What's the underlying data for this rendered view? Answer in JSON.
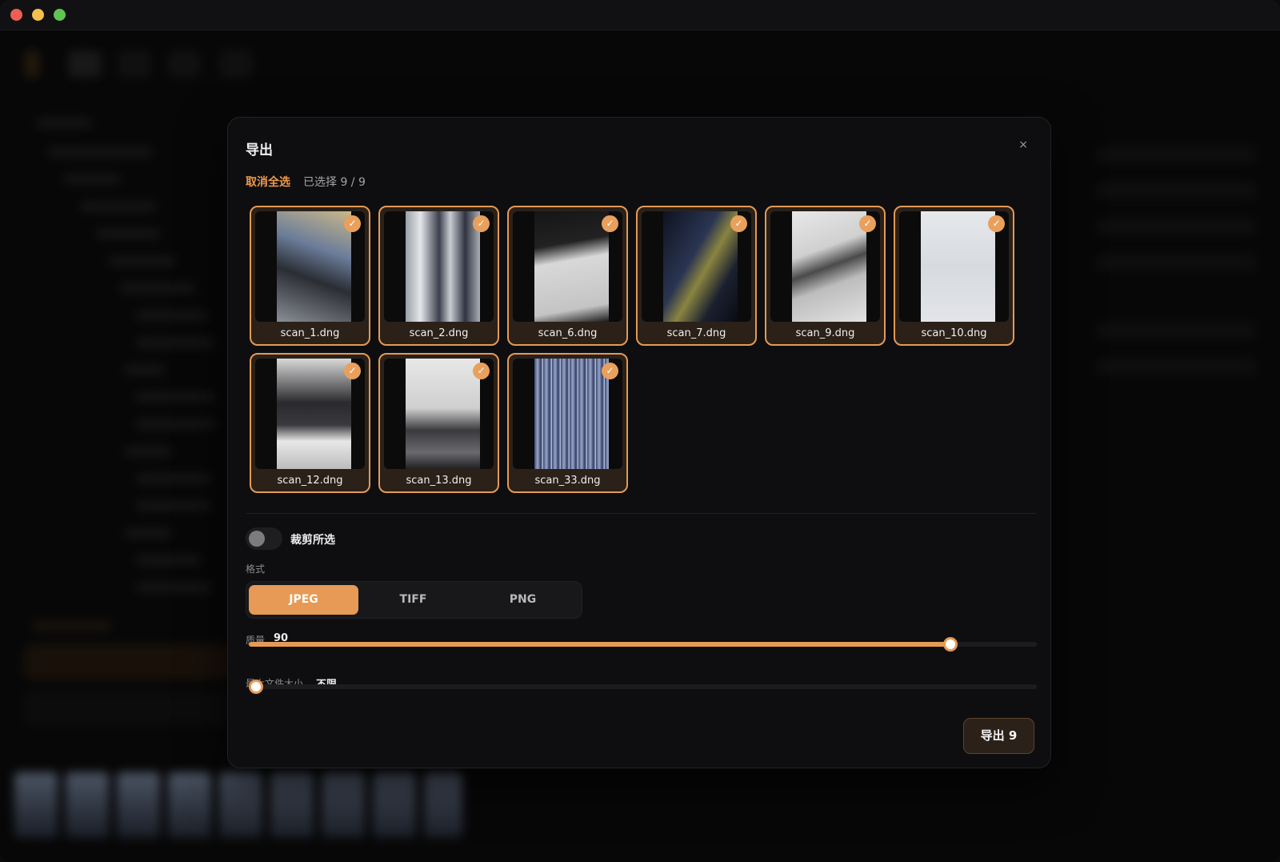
{
  "dialog": {
    "title": "导出",
    "close_symbol": "×",
    "deselect_all": "取消全选",
    "selection_count": "已选择 9 / 9",
    "crop_label": "裁剪所选",
    "crop_enabled": false,
    "format_label": "格式",
    "formats": [
      "JPEG",
      "TIFF",
      "PNG"
    ],
    "selected_format": "JPEG",
    "quality_label": "质量",
    "quality_value": "90",
    "quality_fraction": 0.89,
    "max_size_label": "最大文件大小",
    "max_size_value": "不限",
    "max_size_fraction": 0.0,
    "export_button": "导出 9"
  },
  "files": [
    {
      "name": "scan_1.dng",
      "checked": true
    },
    {
      "name": "scan_2.dng",
      "checked": true
    },
    {
      "name": "scan_6.dng",
      "checked": true
    },
    {
      "name": "scan_7.dng",
      "checked": true
    },
    {
      "name": "scan_9.dng",
      "checked": true
    },
    {
      "name": "scan_10.dng",
      "checked": true
    },
    {
      "name": "scan_12.dng",
      "checked": true
    },
    {
      "name": "scan_13.dng",
      "checked": true
    },
    {
      "name": "scan_33.dng",
      "checked": true
    }
  ],
  "icons": {
    "check": "check-icon",
    "close": "close-icon"
  },
  "colors": {
    "accent": "#e69a55",
    "accent_text": "#ee9a4d",
    "dialog_bg": "#0e0e10"
  }
}
